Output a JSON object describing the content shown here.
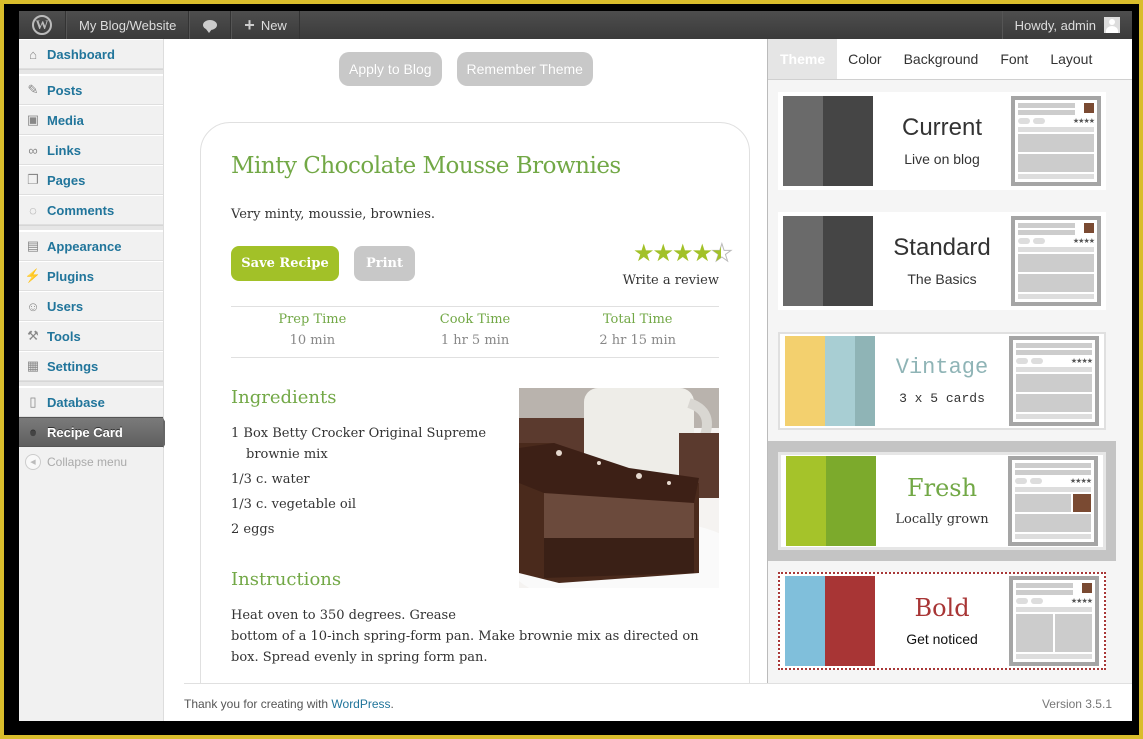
{
  "adminbar": {
    "site_name": "My Blog/Website",
    "new_label": "New",
    "howdy": "Howdy, admin"
  },
  "sidebar": {
    "items": [
      {
        "label": "Dashboard",
        "icon": "home-icon"
      },
      {
        "label": "Posts",
        "icon": "pushpin-icon"
      },
      {
        "label": "Media",
        "icon": "media-icon"
      },
      {
        "label": "Links",
        "icon": "link-icon"
      },
      {
        "label": "Pages",
        "icon": "pages-icon"
      },
      {
        "label": "Comments",
        "icon": "comment-icon"
      },
      {
        "label": "Appearance",
        "icon": "appearance-icon"
      },
      {
        "label": "Plugins",
        "icon": "plug-icon"
      },
      {
        "label": "Users",
        "icon": "users-icon"
      },
      {
        "label": "Tools",
        "icon": "tools-icon"
      },
      {
        "label": "Settings",
        "icon": "settings-icon"
      },
      {
        "label": "Database",
        "icon": "database-icon"
      },
      {
        "label": "Recipe Card",
        "icon": "recipe-card-icon"
      }
    ],
    "collapse_label": "Collapse menu"
  },
  "main": {
    "apply_label": "Apply to Blog",
    "remember_label": "Remember Theme"
  },
  "recipe": {
    "title": "Minty Chocolate Mousse Brownies",
    "description": "Very minty, moussie, brownies.",
    "save_label": "Save Recipe",
    "print_label": "Print",
    "rating": 4.5,
    "rating_max": 5,
    "write_review": "Write a review",
    "times": [
      {
        "label": "Prep Time",
        "value": "10 min"
      },
      {
        "label": "Cook Time",
        "value": "1 hr 5 min"
      },
      {
        "label": "Total Time",
        "value": "2 hr 15 min"
      }
    ],
    "ingredients_title": "Ingredients",
    "ingredients": [
      "1 Box Betty Crocker Original Supreme brownie mix",
      "1/3 c. water",
      "1/3 c. vegetable oil",
      "2 eggs"
    ],
    "instructions_title": "Instructions",
    "instructions_line1": "Heat oven to 350 degrees. Grease",
    "instructions_line2": "bottom of a 10-inch spring-form pan. Make brownie mix as directed on box. Spread evenly in spring form pan."
  },
  "footer": {
    "thanks": "Thank you for creating with ",
    "wp_link": "WordPress",
    "period": ".",
    "version": "Version 3.5.1"
  },
  "panel": {
    "tabs": [
      "Theme",
      "Color",
      "Background",
      "Font",
      "Layout"
    ],
    "active_tab": "Theme",
    "themes": [
      {
        "name": "Current",
        "subtitle": "Live on blog",
        "colors": [
          "#6a6a6a",
          "#454545"
        ],
        "name_color": "#333333"
      },
      {
        "name": "Standard",
        "subtitle": "The Basics",
        "colors": [
          "#6a6a6a",
          "#454545"
        ],
        "name_color": "#333333"
      },
      {
        "name": "Vintage",
        "subtitle": "3 x 5 cards",
        "colors": [
          "#f3d06e",
          "#a8ced3",
          "#8fb4b6"
        ],
        "name_color": "#8fb4b6"
      },
      {
        "name": "Fresh",
        "subtitle": "Locally grown",
        "colors": [
          "#a5c32a",
          "#7caa2c"
        ],
        "name_color": "#72a846"
      },
      {
        "name": "Bold",
        "subtitle": "Get noticed",
        "colors": [
          "#80bfdb",
          "#a83535"
        ],
        "name_color": "#a83535"
      }
    ],
    "selected_theme": "Fresh"
  },
  "colors": {
    "accent_green": "#a2c128",
    "title_green": "#72a846",
    "link_blue": "#21759b"
  }
}
